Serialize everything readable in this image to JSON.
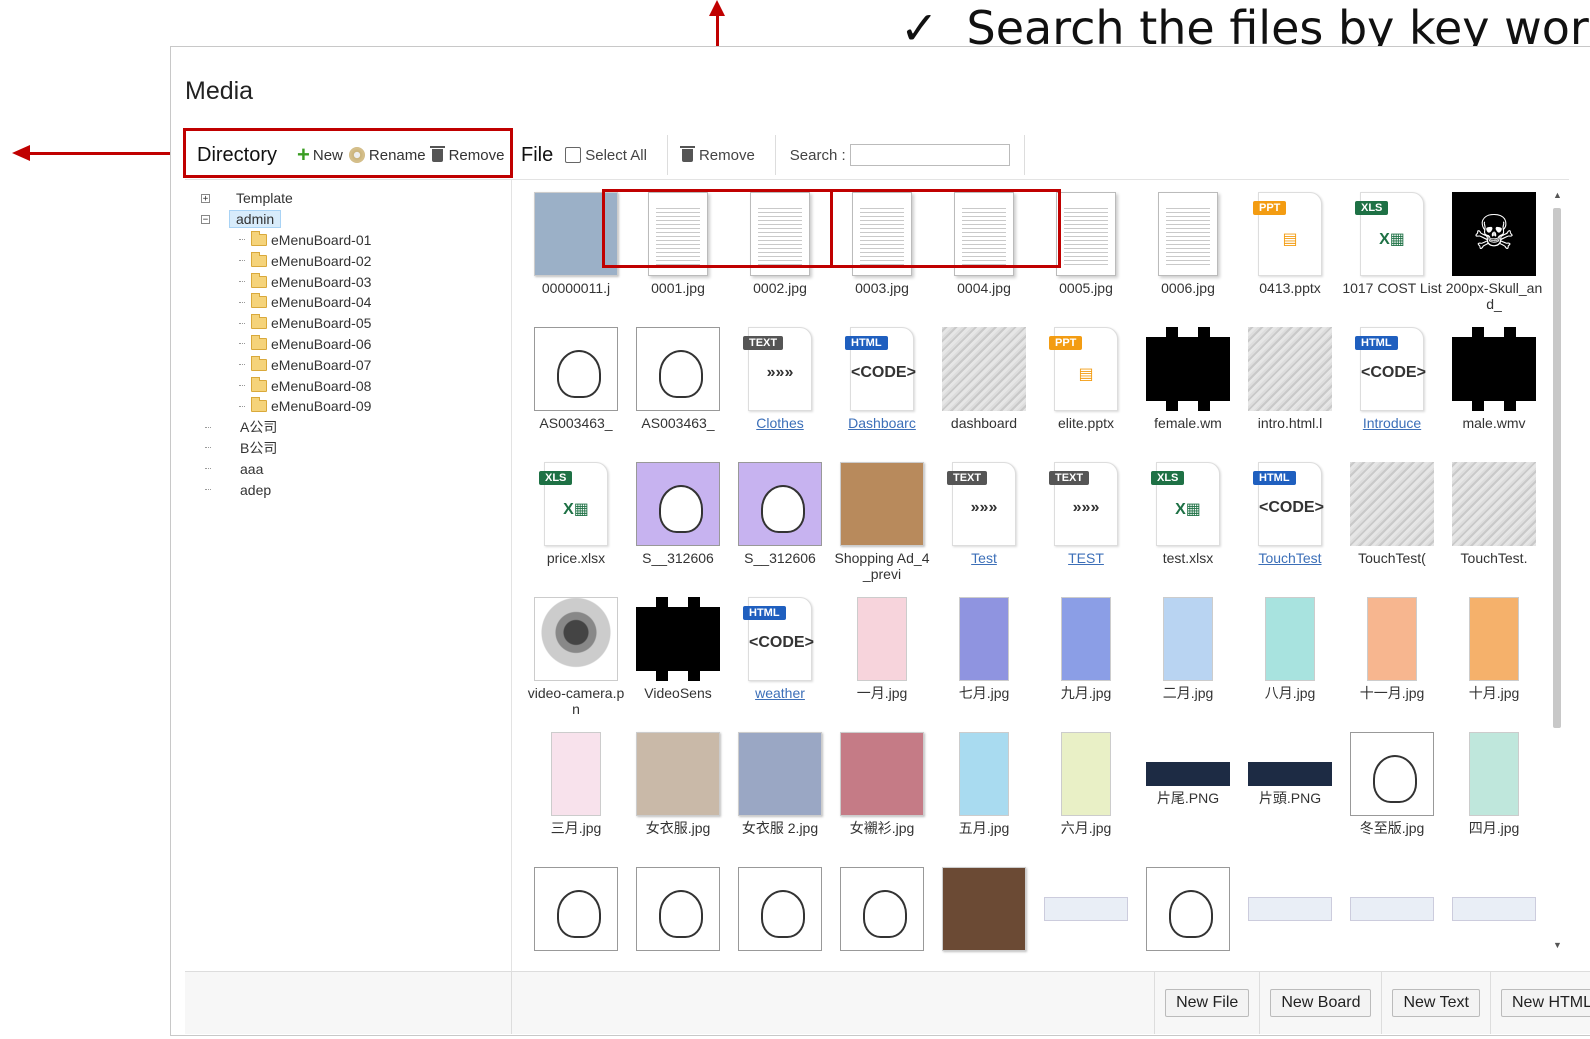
{
  "annotation": {
    "check": "✓",
    "text": "Search the files by key words"
  },
  "window": {
    "title": "Media"
  },
  "directory": {
    "title": "Directory",
    "new_label": "New",
    "rename_label": "Rename",
    "remove_label": "Remove",
    "tree": {
      "template": "Template",
      "admin": "admin",
      "children": [
        "eMenuBoard-01",
        "eMenuBoard-02",
        "eMenuBoard-03",
        "eMenuBoard-04",
        "eMenuBoard-05",
        "eMenuBoard-06",
        "eMenuBoard-07",
        "eMenuBoard-08",
        "eMenuBoard-09"
      ],
      "others": [
        "A公司",
        "B公司",
        "aaa",
        "adep"
      ]
    }
  },
  "file": {
    "title": "File",
    "select_all_label": "Select All",
    "remove_label": "Remove",
    "search_label": "Search :",
    "search_value": ""
  },
  "files": [
    {
      "name": "00000011.j",
      "kind": "photo",
      "color": "#9bb0c7"
    },
    {
      "name": "0001.jpg",
      "kind": "doc"
    },
    {
      "name": "0002.jpg",
      "kind": "doc"
    },
    {
      "name": "0003.jpg",
      "kind": "doc"
    },
    {
      "name": "0004.jpg",
      "kind": "doc"
    },
    {
      "name": "0005.jpg",
      "kind": "doc"
    },
    {
      "name": "0006.jpg",
      "kind": "doc"
    },
    {
      "name": "0413.pptx",
      "kind": "ppt",
      "badge": "PPT",
      "glyph": "▤"
    },
    {
      "name": "1017 COST List",
      "kind": "xls",
      "badge": "XLS",
      "glyph": "X▦"
    },
    {
      "name": "200px-Skull_and_",
      "kind": "skull",
      "glyph": "☠"
    },
    {
      "name": "AS003463_",
      "kind": "bunny"
    },
    {
      "name": "AS003463_",
      "kind": "bunny"
    },
    {
      "name": "Clothes",
      "kind": "text",
      "badge": "TEXT",
      "glyph": "»»»",
      "link": true
    },
    {
      "name": "Dashboarc",
      "kind": "html",
      "badge": "HTML",
      "glyph": "<CODE>",
      "link": true
    },
    {
      "name": "dashboard",
      "kind": "gray"
    },
    {
      "name": "elite.pptx",
      "kind": "ppt",
      "badge": "PPT",
      "glyph": "▤"
    },
    {
      "name": "female.wm",
      "kind": "film"
    },
    {
      "name": "intro.html.l",
      "kind": "gray"
    },
    {
      "name": "Introduce",
      "kind": "html",
      "badge": "HTML",
      "glyph": "<CODE>",
      "link": true
    },
    {
      "name": "male.wmv",
      "kind": "film"
    },
    {
      "name": "price.xlsx",
      "kind": "xls",
      "badge": "XLS",
      "glyph": "X▦"
    },
    {
      "name": "S__312606",
      "kind": "bunny-purple"
    },
    {
      "name": "S__312606",
      "kind": "bunny-purple"
    },
    {
      "name": "Shopping Ad_4_previ",
      "kind": "photo",
      "color": "#b88a5c"
    },
    {
      "name": "Test",
      "kind": "text",
      "badge": "TEXT",
      "glyph": "»»»",
      "link": true
    },
    {
      "name": "TEST",
      "kind": "text",
      "badge": "TEXT",
      "glyph": "»»»",
      "link": true
    },
    {
      "name": "test.xlsx",
      "kind": "xls",
      "badge": "XLS",
      "glyph": "X▦"
    },
    {
      "name": "TouchTest",
      "kind": "html",
      "badge": "HTML",
      "glyph": "<CODE>",
      "link": true
    },
    {
      "name": "TouchTest(",
      "kind": "gray"
    },
    {
      "name": "TouchTest.",
      "kind": "gray"
    },
    {
      "name": "video-camera.pn",
      "kind": "camera"
    },
    {
      "name": "VideoSens",
      "kind": "film"
    },
    {
      "name": "weather",
      "kind": "html",
      "badge": "HTML",
      "glyph": "<CODE>",
      "link": true
    },
    {
      "name": "一月.jpg",
      "kind": "pastel",
      "color": "#f7d4dc"
    },
    {
      "name": "七月.jpg",
      "kind": "pastel",
      "color": "#8f94e0"
    },
    {
      "name": "九月.jpg",
      "kind": "pastel",
      "color": "#8b9ee6"
    },
    {
      "name": "二月.jpg",
      "kind": "pastel",
      "color": "#b9d4f2"
    },
    {
      "name": "八月.jpg",
      "kind": "pastel",
      "color": "#a8e3df"
    },
    {
      "name": "十一月.jpg",
      "kind": "pastel",
      "color": "#f7b68f"
    },
    {
      "name": "十月.jpg",
      "kind": "pastel",
      "color": "#f5b16b"
    },
    {
      "name": "三月.jpg",
      "kind": "pastel",
      "color": "#f8e2ec"
    },
    {
      "name": "女衣服.jpg",
      "kind": "photo",
      "color": "#c9b9a8"
    },
    {
      "name": "女衣服 2.jpg",
      "kind": "photo",
      "color": "#9aa7c4"
    },
    {
      "name": "女襯衫.jpg",
      "kind": "photo",
      "color": "#c57b86"
    },
    {
      "name": "五月.jpg",
      "kind": "pastel",
      "color": "#a9dbf0"
    },
    {
      "name": "六月.jpg",
      "kind": "pastel",
      "color": "#e9f0c6"
    },
    {
      "name": "片尾.PNG",
      "kind": "banner"
    },
    {
      "name": "片頭.PNG",
      "kind": "banner"
    },
    {
      "name": "冬至版.jpg",
      "kind": "bunny"
    },
    {
      "name": "四月.jpg",
      "kind": "pastel",
      "color": "#bfe7dc"
    },
    {
      "name": "",
      "kind": "bunny"
    },
    {
      "name": "",
      "kind": "bunny"
    },
    {
      "name": "",
      "kind": "bunny"
    },
    {
      "name": "",
      "kind": "bunny"
    },
    {
      "name": "",
      "kind": "photo",
      "color": "#6b4a34"
    },
    {
      "name": "",
      "kind": "banner-light"
    },
    {
      "name": "",
      "kind": "bunny"
    },
    {
      "name": "",
      "kind": "banner-light"
    },
    {
      "name": "",
      "kind": "banner-light"
    },
    {
      "name": "",
      "kind": "banner-light"
    }
  ],
  "bottom": {
    "new_file": "New File",
    "new_board": "New Board",
    "new_text": "New Text",
    "new_html": "New HTML"
  },
  "colors": {
    "accent_red": "#c00000",
    "ppt": "#f39c12",
    "xls": "#1e7145",
    "html": "#1f5fbf",
    "text_badge": "#555555"
  }
}
